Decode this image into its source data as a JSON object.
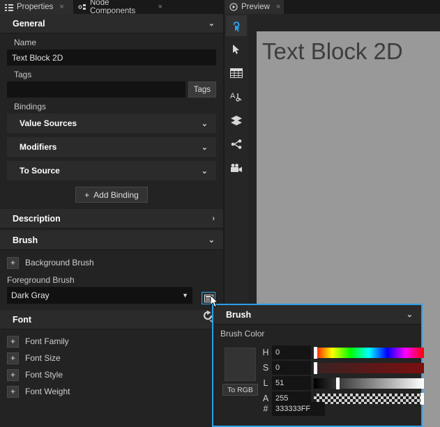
{
  "tabs": [
    {
      "label": "Properties",
      "icon": "list-icon",
      "active": true,
      "close": "×"
    },
    {
      "label": "Node Components",
      "icon": "node-icon",
      "active": false,
      "close": "×"
    },
    {
      "label": "Preview",
      "icon": "play-circle-icon",
      "active": true,
      "close": "×"
    }
  ],
  "properties": {
    "general": {
      "title": "General",
      "chevron": "⌄"
    },
    "name": {
      "label": "Name",
      "value": "Text Block 2D"
    },
    "tags": {
      "label": "Tags",
      "value": "",
      "button": "Tags"
    },
    "bindings": {
      "label": "Bindings",
      "sections": [
        {
          "title": "Value Sources",
          "chevron": "⌄"
        },
        {
          "title": "Modifiers",
          "chevron": "⌄"
        },
        {
          "title": "To Source",
          "chevron": "⌄"
        }
      ],
      "add_button": "Add Binding",
      "add_icon": "+"
    },
    "description": {
      "title": "Description",
      "chevron": "›"
    },
    "brush": {
      "title": "Brush",
      "chevron": "⌄",
      "background_brush": {
        "label": "Background Brush",
        "add": "+"
      },
      "foreground_brush": {
        "label": "Foreground Brush",
        "value": "Dark Gray",
        "caret": "▼"
      },
      "edit_icon": "brush-editor-icon",
      "reset_icon": "reset-icon"
    },
    "font": {
      "title": "Font",
      "chevron": "⌄",
      "items": [
        {
          "label": "Font Family",
          "add": "+"
        },
        {
          "label": "Font Size",
          "add": "+"
        },
        {
          "label": "Font Style",
          "add": "+"
        },
        {
          "label": "Font Weight",
          "add": "+"
        }
      ]
    }
  },
  "preview": {
    "tools": [
      {
        "name": "interact-cursor-tool",
        "selected": true
      },
      {
        "name": "select-arrow-tool",
        "selected": false
      },
      {
        "name": "grid-table-tool",
        "selected": false
      },
      {
        "name": "text-layout-tool",
        "selected": false
      },
      {
        "name": "layers-tool",
        "selected": false
      },
      {
        "name": "node-graph-tool",
        "selected": false
      },
      {
        "name": "camera-tool",
        "selected": false
      }
    ],
    "canvas_text": "Text Block 2D",
    "canvas_bg": "#999999",
    "text_color": "#3d3d3d"
  },
  "brush_popup": {
    "title": "Brush",
    "chevron": "⌄",
    "color_label": "Brush Color",
    "swatch_color": "#333333",
    "to_rgb_button": "To RGB",
    "channels": [
      {
        "key": "H",
        "value": "0",
        "thumb_pct": 0
      },
      {
        "key": "S",
        "value": "0",
        "thumb_pct": 0
      },
      {
        "key": "L",
        "value": "51",
        "thumb_pct": 20
      },
      {
        "key": "A",
        "value": "255",
        "thumb_pct": 97
      }
    ],
    "hex": {
      "key": "#",
      "value": "333333FF"
    },
    "accent": "#2aa0e8"
  }
}
